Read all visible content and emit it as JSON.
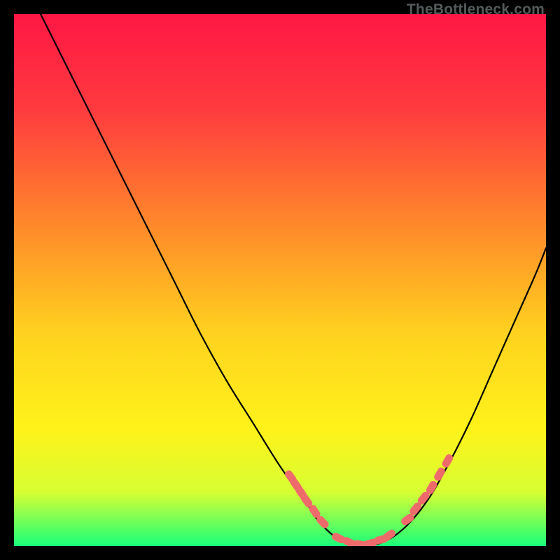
{
  "watermark": "TheBottleneck.com",
  "chart_data": {
    "type": "line",
    "title": "",
    "xlabel": "",
    "ylabel": "",
    "xlim": [
      0,
      100
    ],
    "ylim": [
      0,
      100
    ],
    "gradient_stops": [
      {
        "offset": 0,
        "color": "#ff1744"
      },
      {
        "offset": 18,
        "color": "#ff3b3f"
      },
      {
        "offset": 40,
        "color": "#ff8a2a"
      },
      {
        "offset": 60,
        "color": "#ffd21f"
      },
      {
        "offset": 78,
        "color": "#fff21a"
      },
      {
        "offset": 90,
        "color": "#d6ff33"
      },
      {
        "offset": 100,
        "color": "#19ff7a"
      }
    ],
    "series": [
      {
        "name": "curve",
        "x": [
          5,
          10,
          15,
          20,
          25,
          30,
          35,
          40,
          45,
          50,
          55,
          57,
          60,
          63,
          66,
          70,
          74,
          78,
          82,
          86,
          90,
          94,
          98,
          100
        ],
        "y": [
          100,
          90,
          80,
          70,
          60,
          50,
          40,
          31,
          23,
          15,
          8,
          5,
          2,
          0.5,
          0,
          1,
          4,
          9,
          16,
          24,
          33,
          42,
          51,
          56
        ]
      }
    ],
    "marker_clusters": [
      {
        "name": "left-cluster",
        "points": [
          {
            "x": 52.0,
            "y": 13.0
          },
          {
            "x": 53.0,
            "y": 11.5
          },
          {
            "x": 54.0,
            "y": 10.0
          },
          {
            "x": 55.0,
            "y": 8.5
          },
          {
            "x": 56.5,
            "y": 6.5
          },
          {
            "x": 58.0,
            "y": 4.5
          }
        ]
      },
      {
        "name": "bottom-cluster",
        "points": [
          {
            "x": 61.0,
            "y": 1.5
          },
          {
            "x": 63.0,
            "y": 0.7
          },
          {
            "x": 65.0,
            "y": 0.3
          },
          {
            "x": 67.0,
            "y": 0.5
          },
          {
            "x": 69.0,
            "y": 1.2
          },
          {
            "x": 70.5,
            "y": 2.0
          }
        ]
      },
      {
        "name": "right-cluster",
        "points": [
          {
            "x": 74.0,
            "y": 5.0
          },
          {
            "x": 75.5,
            "y": 7.0
          },
          {
            "x": 77.0,
            "y": 9.0
          },
          {
            "x": 78.5,
            "y": 11.0
          },
          {
            "x": 80.0,
            "y": 13.5
          },
          {
            "x": 81.5,
            "y": 16.0
          }
        ]
      }
    ]
  }
}
